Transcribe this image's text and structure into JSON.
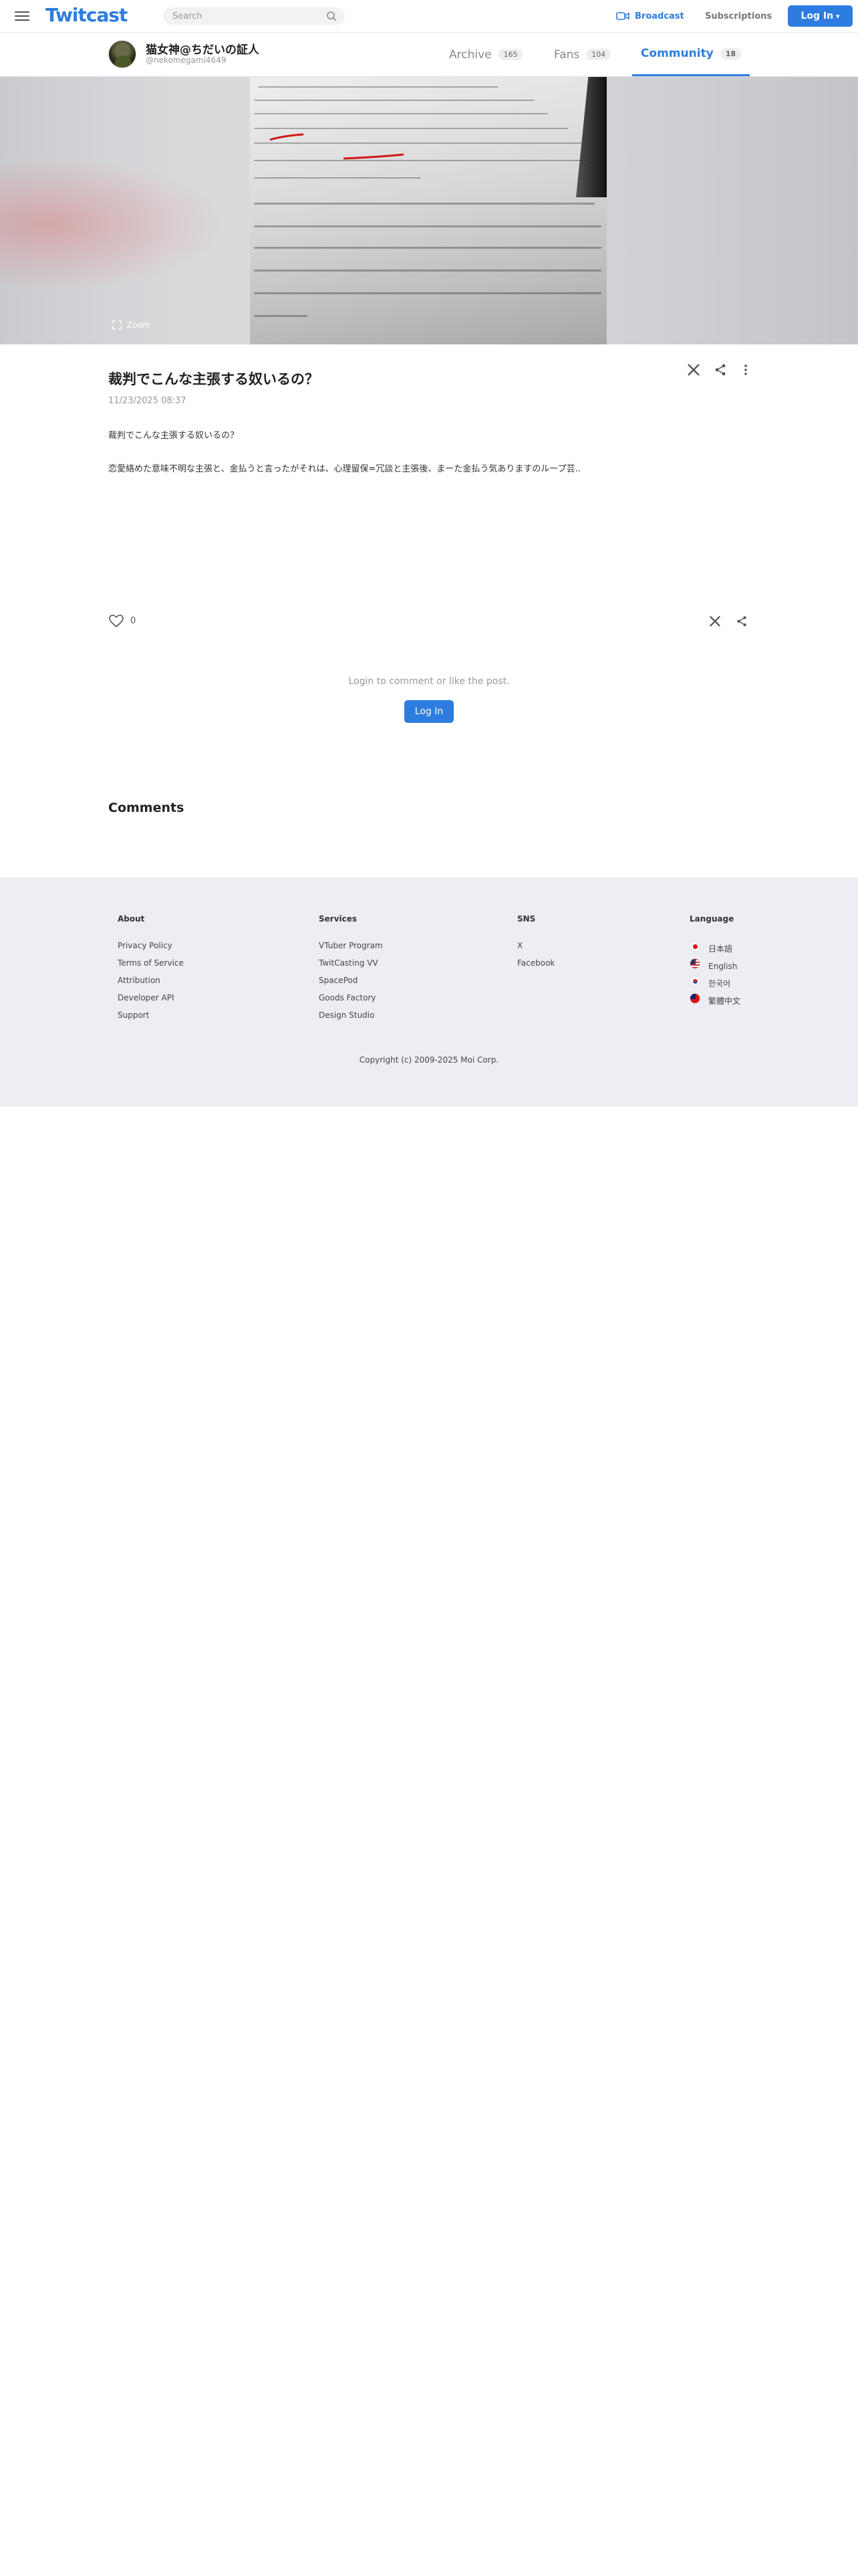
{
  "nav": {
    "logo": "Twitcast",
    "search_placeholder": "Search",
    "broadcast": "Broadcast",
    "subscriptions": "Subscriptions",
    "login": "Log In"
  },
  "profile": {
    "name": "猫女神@ちだいの証人",
    "handle": "@nekomegami4649",
    "tabs": [
      {
        "label": "Archive",
        "count": "165"
      },
      {
        "label": "Fans",
        "count": "104"
      },
      {
        "label": "Community",
        "count": "18"
      }
    ]
  },
  "hero": {
    "zoom_label": "Zoom"
  },
  "post": {
    "title": "裁判でこんな主張する奴いるの？",
    "date": "11/23/2025 08:37",
    "body_line1": "裁判でこんな主張する奴いるの？",
    "body_line2": "恋愛絡めた意味不明な主張と、金払うと言ったがそれは、心理留保=冗談と主張後、まーた金払う気ありますのループ芸..",
    "like_count": "0"
  },
  "login_prompt": {
    "text": "Login to comment or like the post.",
    "button": "Log In"
  },
  "comments_heading": "Comments",
  "footer": {
    "about": {
      "heading": "About",
      "links": [
        "Privacy Policy",
        "Terms of Service",
        "Attribution",
        "Developer API",
        "Support"
      ]
    },
    "services": {
      "heading": "Services",
      "links": [
        "VTuber Program",
        "TwitCasting VV",
        "SpacePod",
        "Goods Factory",
        "Design Studio"
      ]
    },
    "sns": {
      "heading": "SNS",
      "links": [
        "X",
        "Facebook"
      ]
    },
    "language": {
      "heading": "Language",
      "links": [
        "日本語",
        "English",
        "한국어",
        "繁體中文"
      ]
    },
    "copyright": "Copyright (c) 2009-2025 Moi Corp."
  },
  "colors": {
    "accent": "#2d7de0",
    "footer_bg": "#eceef3"
  }
}
